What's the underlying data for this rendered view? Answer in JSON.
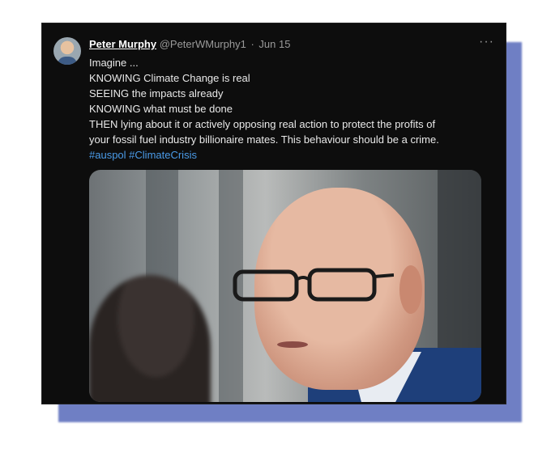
{
  "tweet": {
    "author_name": "Peter Murphy",
    "handle": "@PeterWMurphy1",
    "separator": "·",
    "date": "Jun 15",
    "more_icon": "more-horizontal-icon",
    "lines": [
      "Imagine ...",
      "KNOWING Climate Change is real",
      "SEEING the impacts already",
      "KNOWING what must be done",
      "THEN lying about it or actively opposing real action to protect the profits of",
      "your fossil fuel industry billionaire mates. This behaviour should be a crime."
    ],
    "hashtags": [
      "#auspol",
      "#ClimateCrisis"
    ]
  },
  "colors": {
    "card_background": "#0d0d0d",
    "frame_shadow": "#6f7fc4",
    "hashtag": "#4a9be8",
    "text": "#e9e9e9",
    "muted": "#9a9a9a"
  }
}
